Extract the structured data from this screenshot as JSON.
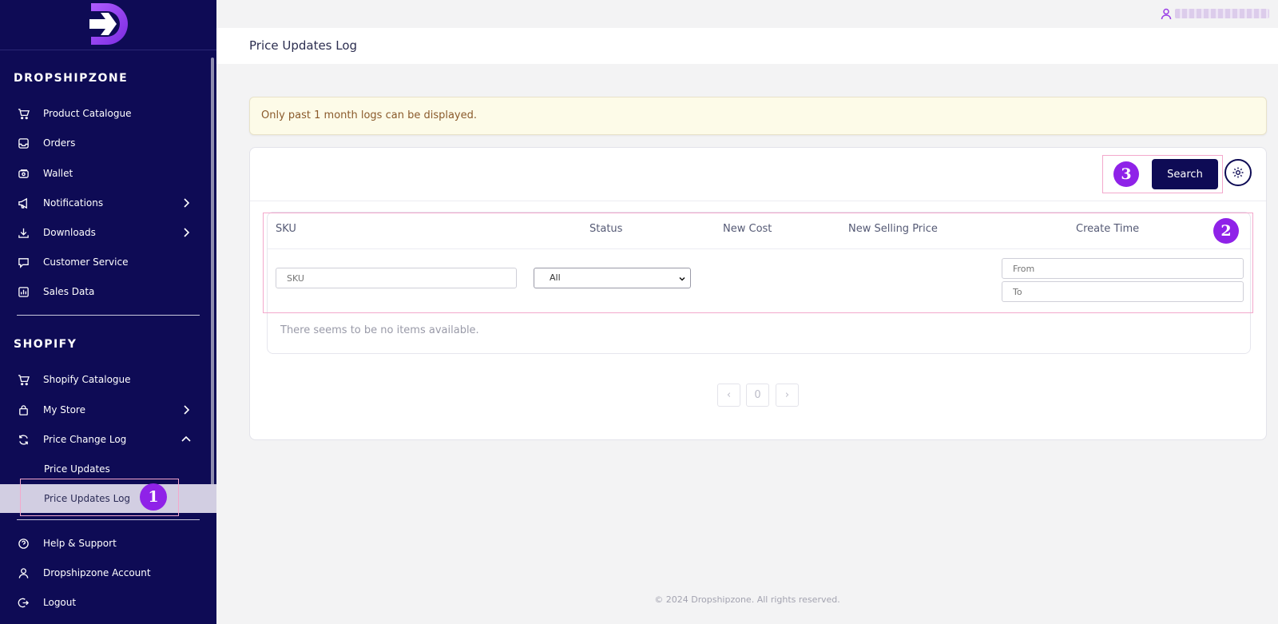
{
  "brand": {
    "logo_icon": "dropshipzone-arrow-logo"
  },
  "sidebar": {
    "sections": [
      {
        "title": "DROPSHIPZONE",
        "items": [
          {
            "label": "Product Catalogue",
            "icon": "cart-icon",
            "has_chevron": false
          },
          {
            "label": "Orders",
            "icon": "inbox-icon",
            "has_chevron": false
          },
          {
            "label": "Wallet",
            "icon": "wallet-icon",
            "has_chevron": false
          },
          {
            "label": "Notifications",
            "icon": "megaphone-icon",
            "has_chevron": true
          },
          {
            "label": "Downloads",
            "icon": "download-icon",
            "has_chevron": true
          },
          {
            "label": "Customer Service",
            "icon": "chat-icon",
            "has_chevron": false
          },
          {
            "label": "Sales Data",
            "icon": "bar-chart-icon",
            "has_chevron": false
          }
        ]
      },
      {
        "title": "SHOPIFY",
        "items": [
          {
            "label": "Shopify Catalogue",
            "icon": "cart-icon",
            "has_chevron": false
          },
          {
            "label": "My Store",
            "icon": "bag-icon",
            "has_chevron": true
          },
          {
            "label": "Price Change Log",
            "icon": "refresh-icon",
            "has_chevron": true,
            "expanded": true,
            "children": [
              {
                "label": "Price Updates",
                "active": false
              },
              {
                "label": "Price Updates Log",
                "active": true
              }
            ]
          }
        ]
      }
    ],
    "bottom_items": [
      {
        "label": "Help & Support",
        "icon": "help-icon"
      },
      {
        "label": "Dropshipzone Account",
        "icon": "user-icon"
      },
      {
        "label": "Logout",
        "icon": "logout-icon"
      }
    ]
  },
  "header": {
    "page_title": "Price Updates Log",
    "user_icon": "user-icon"
  },
  "notice": {
    "text": "Only past 1 month logs can be displayed."
  },
  "toolbar": {
    "search_label": "Search",
    "settings_icon": "gear-icon"
  },
  "table": {
    "columns": [
      "SKU",
      "Status",
      "New Cost",
      "New Selling Price",
      "Create Time"
    ],
    "filters": {
      "sku_placeholder": "SKU",
      "status_selected": "All",
      "from_placeholder": "From",
      "to_placeholder": "To"
    },
    "empty_message": "There seems to be no items available."
  },
  "pagination": {
    "prev": "‹",
    "current": "0",
    "next": "›"
  },
  "annotations": {
    "badge_1": "1",
    "badge_2": "2",
    "badge_3": "3"
  },
  "footer": {
    "text": "© 2024 Dropshipzone. All rights reserved."
  },
  "colors": {
    "sidebar_bg": "#0e0b55",
    "accent_purple": "#8f22e8",
    "active_item_bg": "#d2cee2",
    "notice_bg": "#fdfbe8",
    "highlight_border": "#f3a8cc"
  }
}
